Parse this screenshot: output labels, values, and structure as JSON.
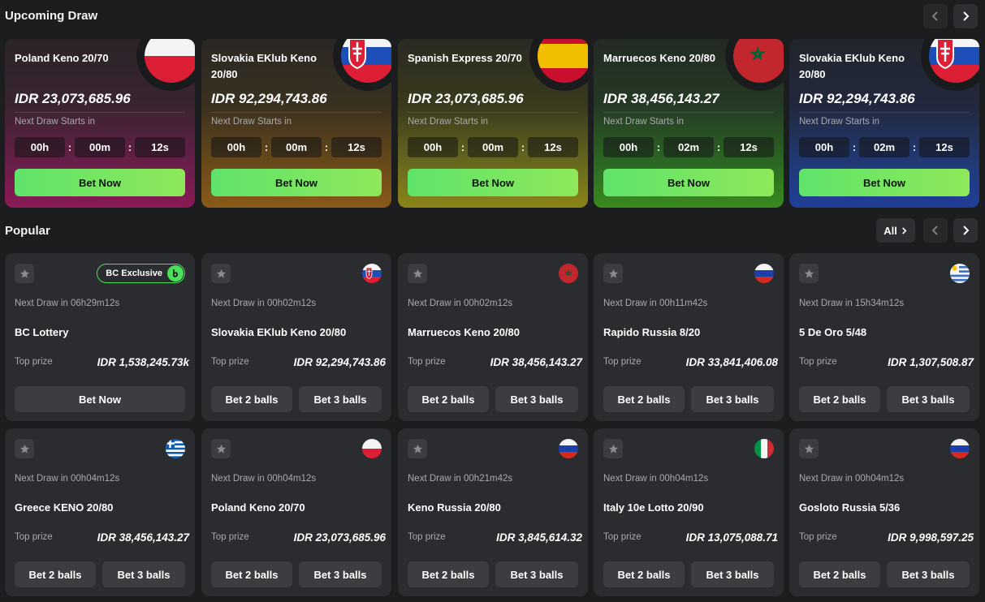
{
  "upcoming": {
    "title": "Upcoming Draw",
    "next_label": "Next Draw Starts in",
    "bet_label": "Bet Now",
    "cards": [
      {
        "name": "Poland Keno 20/70",
        "amount": "IDR 23,073,685.96",
        "h": "00h",
        "m": "00m",
        "s": "12s",
        "flag": "poland-flag-icon"
      },
      {
        "name": "Slovakia EKlub Keno 20/80",
        "amount": "IDR 92,294,743.86",
        "h": "00h",
        "m": "00m",
        "s": "12s",
        "flag": "slovakia-flag-icon"
      },
      {
        "name": "Spanish Express 20/70",
        "amount": "IDR 23,073,685.96",
        "h": "00h",
        "m": "00m",
        "s": "12s",
        "flag": "spain-flag-icon"
      },
      {
        "name": "Marruecos Keno 20/80",
        "amount": "IDR 38,456,143.27",
        "h": "00h",
        "m": "02m",
        "s": "12s",
        "flag": "morocco-flag-icon"
      },
      {
        "name": "Slovakia EKlub Keno 20/80",
        "amount": "IDR 92,294,743.86",
        "h": "00h",
        "m": "02m",
        "s": "12s",
        "flag": "slovakia-flag-icon"
      }
    ]
  },
  "popular": {
    "title": "Popular",
    "all_label": "All",
    "top_prize_label": "Top prize",
    "bet2_label": "Bet 2 balls",
    "bet3_label": "Bet 3 balls",
    "bet_now_label": "Bet Now",
    "exclusive_label": "BC Exclusive",
    "cards": [
      {
        "name": "BC Lottery",
        "next": "Next Draw in 06h29m12s",
        "prize": "IDR 1,538,245.73k",
        "flag": "bc-exclusive-badge"
      },
      {
        "name": "Slovakia EKlub Keno 20/80",
        "next": "Next Draw in 00h02m12s",
        "prize": "IDR 92,294,743.86",
        "flag": "slovakia-flag-icon"
      },
      {
        "name": "Marruecos Keno 20/80",
        "next": "Next Draw in 00h02m12s",
        "prize": "IDR 38,456,143.27",
        "flag": "morocco-flag-icon"
      },
      {
        "name": "Rapido Russia 8/20",
        "next": "Next Draw in 00h11m42s",
        "prize": "IDR 33,841,406.08",
        "flag": "russia-flag-icon"
      },
      {
        "name": "5 De Oro 5/48",
        "next": "Next Draw in 15h34m12s",
        "prize": "IDR 1,307,508.87",
        "flag": "uruguay-flag-icon"
      },
      {
        "name": "Greece KENO 20/80",
        "next": "Next Draw in 00h04m12s",
        "prize": "IDR 38,456,143.27",
        "flag": "greece-flag-icon"
      },
      {
        "name": "Poland Keno 20/70",
        "next": "Next Draw in 00h04m12s",
        "prize": "IDR 23,073,685.96",
        "flag": "poland-flag-icon"
      },
      {
        "name": "Keno Russia 20/80",
        "next": "Next Draw in 00h21m42s",
        "prize": "IDR 3,845,614.32",
        "flag": "russia-flag-icon"
      },
      {
        "name": "Italy 10e Lotto 20/90",
        "next": "Next Draw in 00h04m12s",
        "prize": "IDR 13,075,088.71",
        "flag": "italy-flag-icon"
      },
      {
        "name": "Gosloto Russia 5/36",
        "next": "Next Draw in 00h04m12s",
        "prize": "IDR 9,998,597.25",
        "flag": "russia-flag-icon"
      }
    ]
  },
  "colors": {
    "accent_green": "#5fe36a",
    "background": "#1c1d1f",
    "card": "#2a2c2f"
  }
}
